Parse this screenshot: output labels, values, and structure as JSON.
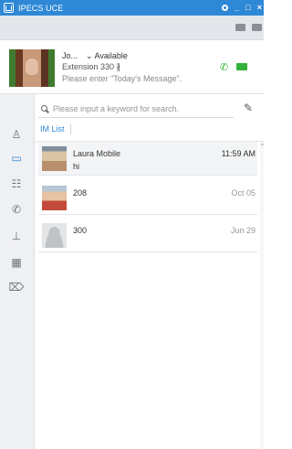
{
  "app": {
    "title": "IPECS UCE"
  },
  "window_controls": {
    "settings": "",
    "minimize": "_",
    "maximize": "□",
    "close": "×"
  },
  "profile": {
    "name": "Jo...",
    "status": "⌄ Available",
    "extension": "Extension 330 ∦",
    "message_placeholder": "Please enter \"Today's Message\"."
  },
  "search": {
    "placeholder": "Please input a keyword for search."
  },
  "tabs": [
    {
      "label": "IM List"
    }
  ],
  "conversations": [
    {
      "name": "Laura Mobile",
      "preview": "hi",
      "time": "11:59 AM"
    },
    {
      "name": "208",
      "preview": "",
      "time": "Oct 05"
    },
    {
      "name": "300",
      "preview": "",
      "time": "Jun 29"
    }
  ],
  "colors": {
    "accent": "#2f88d6",
    "call_green": "#35b23b",
    "titlebar": "#2f88d6"
  },
  "icons": [
    "contacts-icon",
    "chat-icon",
    "history-icon",
    "phone-icon",
    "org-chart-icon",
    "directory-icon",
    "tag-icon"
  ]
}
